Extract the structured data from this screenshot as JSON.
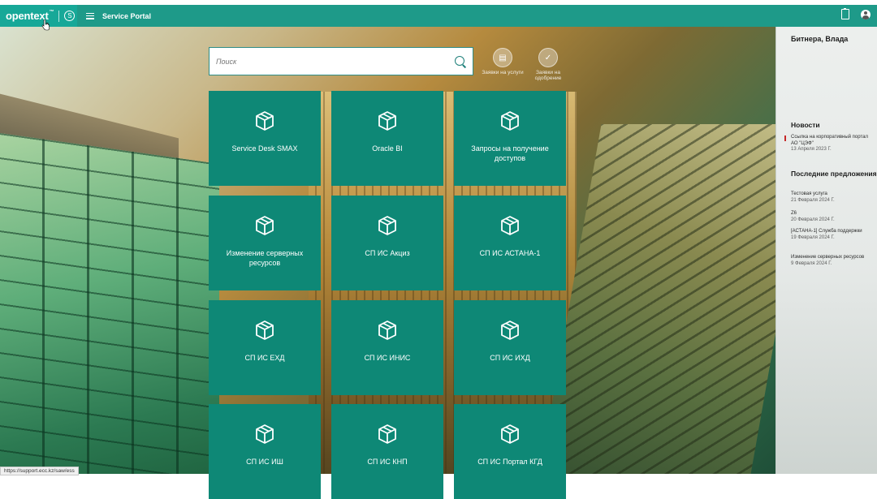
{
  "header": {
    "brand": "opentext",
    "brand_tm": "™",
    "title": "Service Portal"
  },
  "search": {
    "placeholder": "Поиск"
  },
  "quick_links": [
    {
      "label": "Заявки на услуги",
      "icon": "request-icon"
    },
    {
      "label": "Заявки на одобрение",
      "icon": "approval-icon"
    }
  ],
  "tiles": [
    {
      "label": "Service Desk SMAX",
      "icon": "cube-icon"
    },
    {
      "label": "Oracle BI",
      "icon": "cube-icon"
    },
    {
      "label": "Запросы на получение доступов",
      "icon": "cube-icon"
    },
    {
      "label": "Изменение серверных ресурсов",
      "icon": "cube-icon"
    },
    {
      "label": "СП ИС Акциз",
      "icon": "cube-icon"
    },
    {
      "label": "СП ИС АСТАНА-1",
      "icon": "cube-icon"
    },
    {
      "label": "СП ИС ЕХД",
      "icon": "cube-icon"
    },
    {
      "label": "СП ИС ИНИС",
      "icon": "cube-icon"
    },
    {
      "label": "СП ИС ИХД",
      "icon": "cube-icon"
    },
    {
      "label": "СП ИС ИШ",
      "icon": "cube-icon"
    },
    {
      "label": "СП ИС КНП",
      "icon": "cube-icon"
    },
    {
      "label": "СП ИС Портал КГД",
      "icon": "cube-icon"
    }
  ],
  "sidebar": {
    "user_name": "Битнера, Влада",
    "news_title": "Новости",
    "news": [
      {
        "title": "Ссылка на корпоративный портал АО \"ЦЭФ\"",
        "date": "13 Апреля 2023 Г."
      }
    ],
    "offers_title": "Последние предложения",
    "offers": [
      {
        "title": "Тестовая услуга",
        "date": "21 Февраля 2024 Г."
      },
      {
        "title": "Z6",
        "date": "20 Февраля 2024 Г."
      },
      {
        "title": "[АСТАНА-1] Служба поддержки",
        "date": "19 Февраля 2024 Г."
      },
      {
        "title": "Изменение серверных ресурсов",
        "date": "9 Февраля 2024 Г."
      }
    ]
  },
  "status_bar": {
    "url": "https://support.ecc.kz/saw/ess"
  },
  "colors": {
    "header": "#1e9a89",
    "tile": "#0e8876",
    "accent": "#2f8d86"
  }
}
